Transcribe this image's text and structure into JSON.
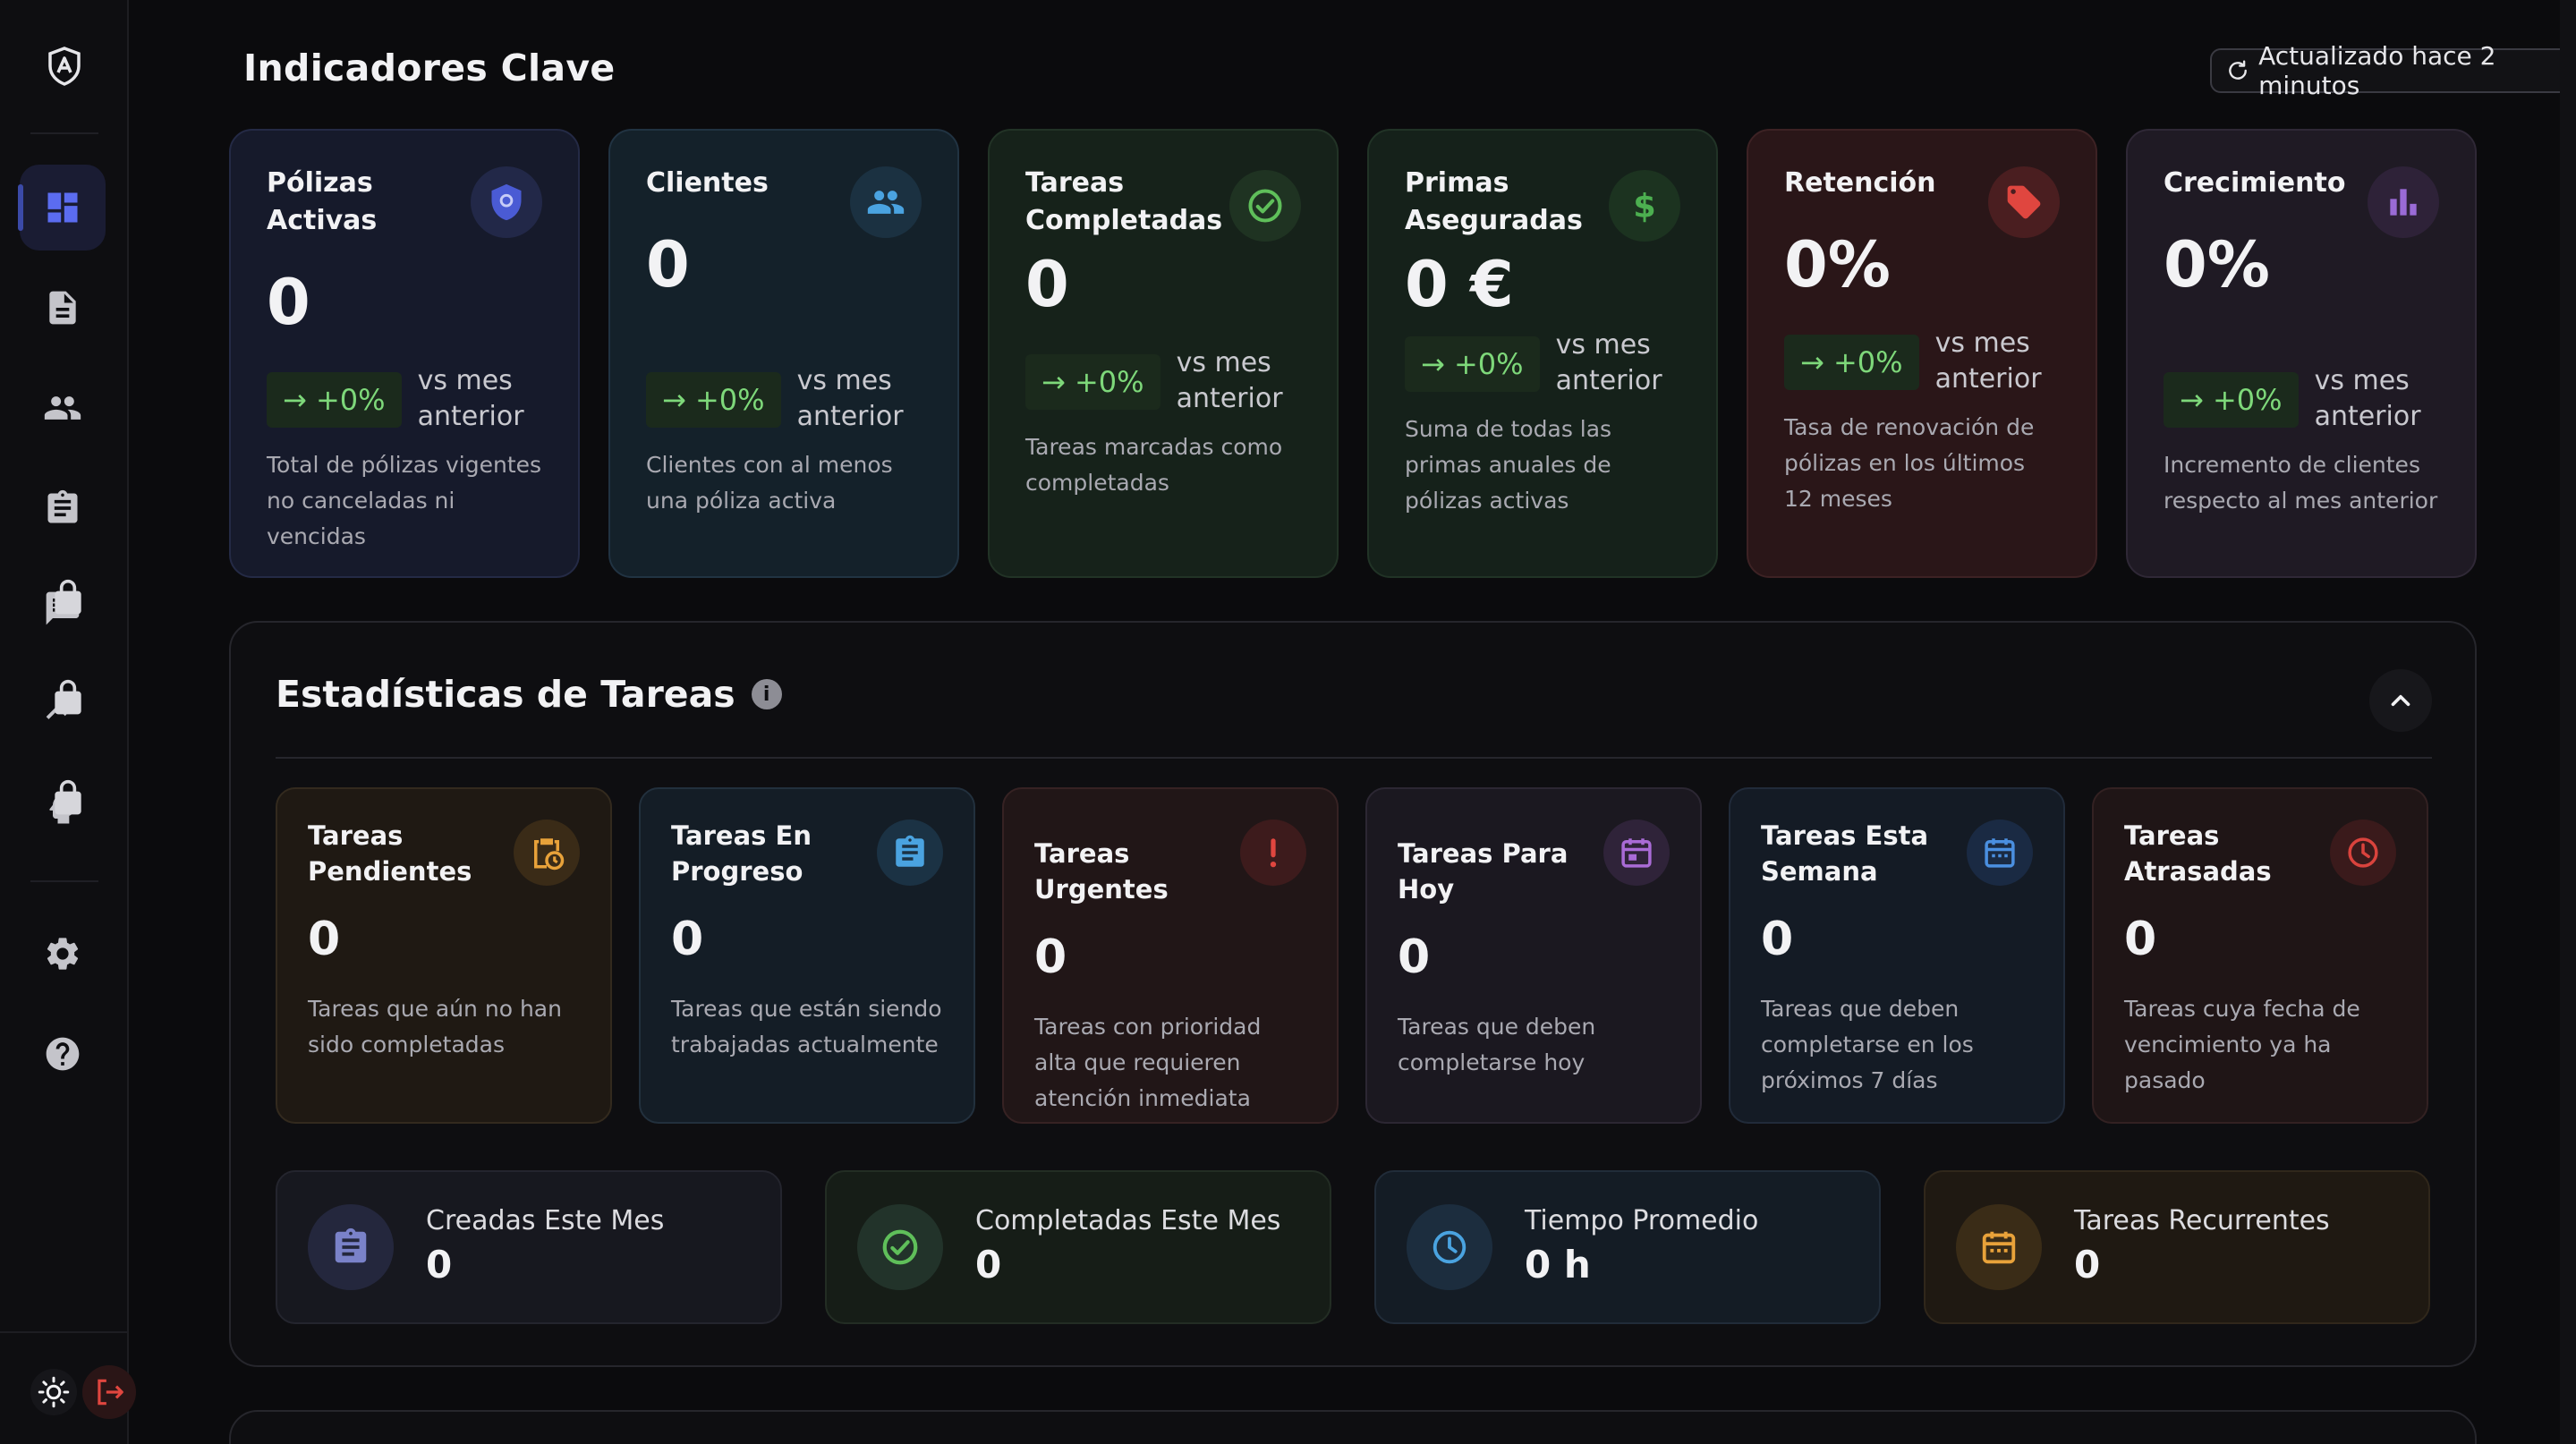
{
  "header": {
    "title": "Indicadores Clave",
    "updated_label": "Actualizado hace 2 minutos"
  },
  "kpis": [
    {
      "title": "Pólizas Activas",
      "value": "0",
      "trend": "→ +0%",
      "vs": "vs mes anterior",
      "desc": "Total de pólizas vigentes no canceladas ni vencidas",
      "icon": "shield-icon",
      "color": "#4a5bd4"
    },
    {
      "title": "Clientes",
      "value": "0",
      "trend": "→ +0%",
      "vs": "vs mes anterior",
      "desc": "Clientes con al menos una póliza activa",
      "icon": "people-icon",
      "color": "#4aa3e0"
    },
    {
      "title": "Tareas Completadas",
      "value": "0",
      "trend": "→ +0%",
      "vs": "vs mes anterior",
      "desc": "Tareas marcadas como completadas",
      "icon": "check-circle-icon",
      "color": "#5fbf5a"
    },
    {
      "title": "Primas Aseguradas",
      "value": "0 €",
      "trend": "→ +0%",
      "vs": "vs mes anterior",
      "desc": "Suma de todas las primas anuales de pólizas activas",
      "icon": "dollar-icon",
      "color": "#4caf50"
    },
    {
      "title": "Retención",
      "value": "0%",
      "trend": "→ +0%",
      "vs": "vs mes anterior",
      "desc": "Tasa de renovación de pólizas en los últimos 12 meses",
      "icon": "tag-icon",
      "color": "#e0463f"
    },
    {
      "title": "Crecimiento",
      "value": "0%",
      "trend": "→ +0%",
      "vs": "vs mes anterior",
      "desc": "Incremento de clientes respecto al mes anterior",
      "icon": "bar-chart-icon",
      "color": "#9a6bd6"
    }
  ],
  "stats": {
    "title": "Estadísticas de Tareas",
    "tasks": [
      {
        "title": "Tareas Pendientes",
        "value": "0",
        "desc": "Tareas que aún no han sido completadas",
        "icon": "clipboard-clock-icon",
        "color": "#e8a23a"
      },
      {
        "title": "Tareas En Progreso",
        "value": "0",
        "desc": "Tareas que están siendo trabajadas actualmente",
        "icon": "clipboard-icon",
        "color": "#4aa3e0"
      },
      {
        "title": "Tareas Urgentes",
        "value": "0",
        "desc": "Tareas con prioridad alta que requieren atención inmediata",
        "icon": "exclamation-icon",
        "color": "#e0463f"
      },
      {
        "title": "Tareas Para Hoy",
        "value": "0",
        "desc": "Tareas que deben completarse hoy",
        "icon": "calendar-today-icon",
        "color": "#a96bd6"
      },
      {
        "title": "Tareas Esta Semana",
        "value": "0",
        "desc": "Tareas que deben completarse en los próximos 7 días",
        "icon": "calendar-week-icon",
        "color": "#4a8fe0"
      },
      {
        "title": "Tareas Atrasadas",
        "value": "0",
        "desc": "Tareas cuya fecha de vencimiento ya ha pasado",
        "icon": "clock-alert-icon",
        "color": "#d9433d"
      }
    ],
    "summary": [
      {
        "label": "Creadas Este Mes",
        "value": "0",
        "icon": "clipboard-list-icon",
        "color": "#7a82c9"
      },
      {
        "label": "Completadas Este Mes",
        "value": "0",
        "icon": "check-circle-icon",
        "color": "#5fbf5a"
      },
      {
        "label": "Tiempo Promedio",
        "value": "0 h",
        "icon": "clock-icon",
        "color": "#4aa3e0"
      },
      {
        "label": "Tareas Recurrentes",
        "value": "0",
        "icon": "calendar-icon",
        "color": "#e8a23a"
      }
    ]
  },
  "sidebar": {
    "items": [
      {
        "name": "dashboard-icon",
        "locked": false,
        "active": true
      },
      {
        "name": "document-icon",
        "locked": false
      },
      {
        "name": "people-icon",
        "locked": false
      },
      {
        "name": "clipboard-icon",
        "locked": false
      },
      {
        "name": "chat-icon",
        "locked": true
      },
      {
        "name": "trend-icon",
        "locked": true
      },
      {
        "name": "ai-head-icon",
        "locked": true
      },
      {
        "name": "settings-icon",
        "locked": false
      },
      {
        "name": "help-icon",
        "locked": false
      }
    ]
  }
}
